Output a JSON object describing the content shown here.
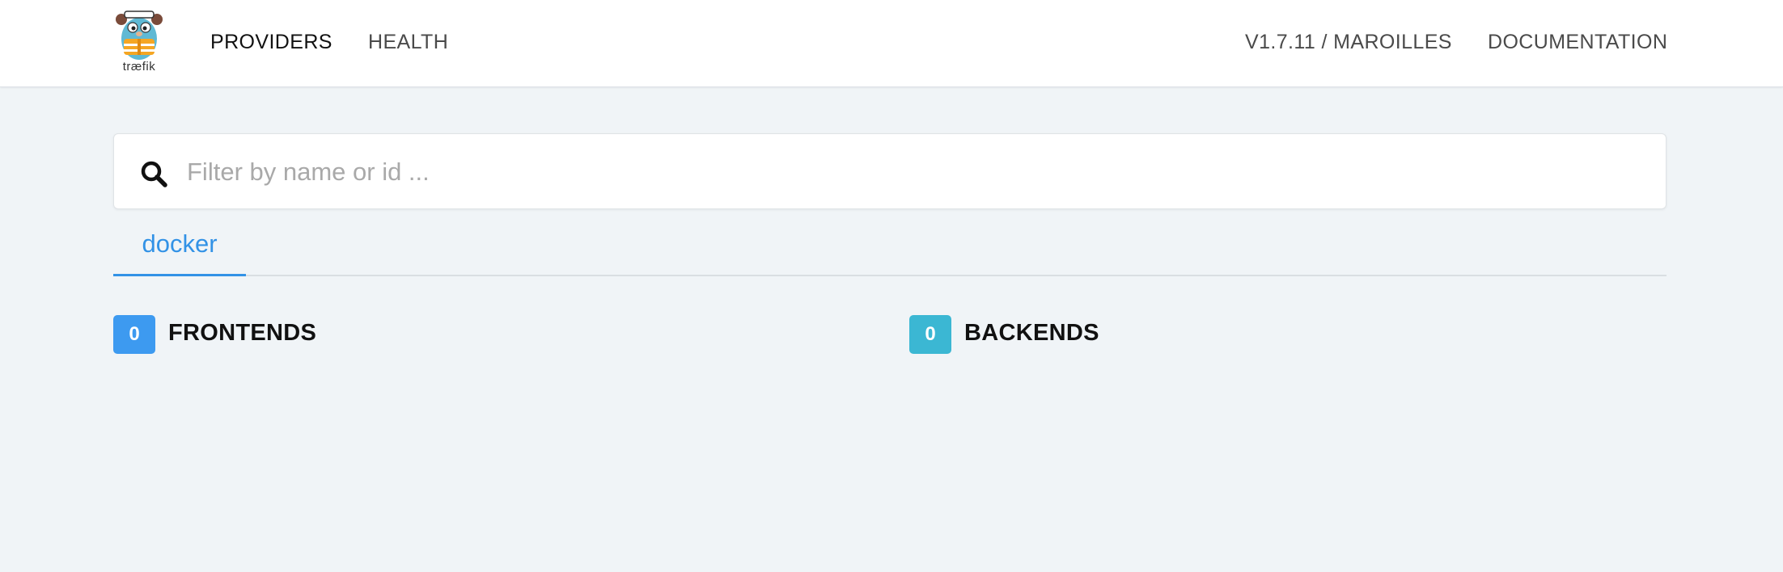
{
  "navbar": {
    "logo_text": "træfik",
    "items": [
      {
        "label": "PROVIDERS",
        "active": true
      },
      {
        "label": "HEALTH",
        "active": false
      }
    ],
    "version": "V1.7.11 / MAROILLES",
    "documentation": "DOCUMENTATION"
  },
  "search": {
    "placeholder": "Filter by name or id ...",
    "value": "",
    "icon": "search-icon"
  },
  "tabs": [
    {
      "label": "docker",
      "active": true
    }
  ],
  "sections": {
    "frontends": {
      "count": "0",
      "title": "FRONTENDS",
      "color": "#3d9af0"
    },
    "backends": {
      "count": "0",
      "title": "BACKENDS",
      "color": "#3bb7d3"
    }
  },
  "colors": {
    "accent": "#3292e6",
    "background": "#f0f4f7"
  }
}
